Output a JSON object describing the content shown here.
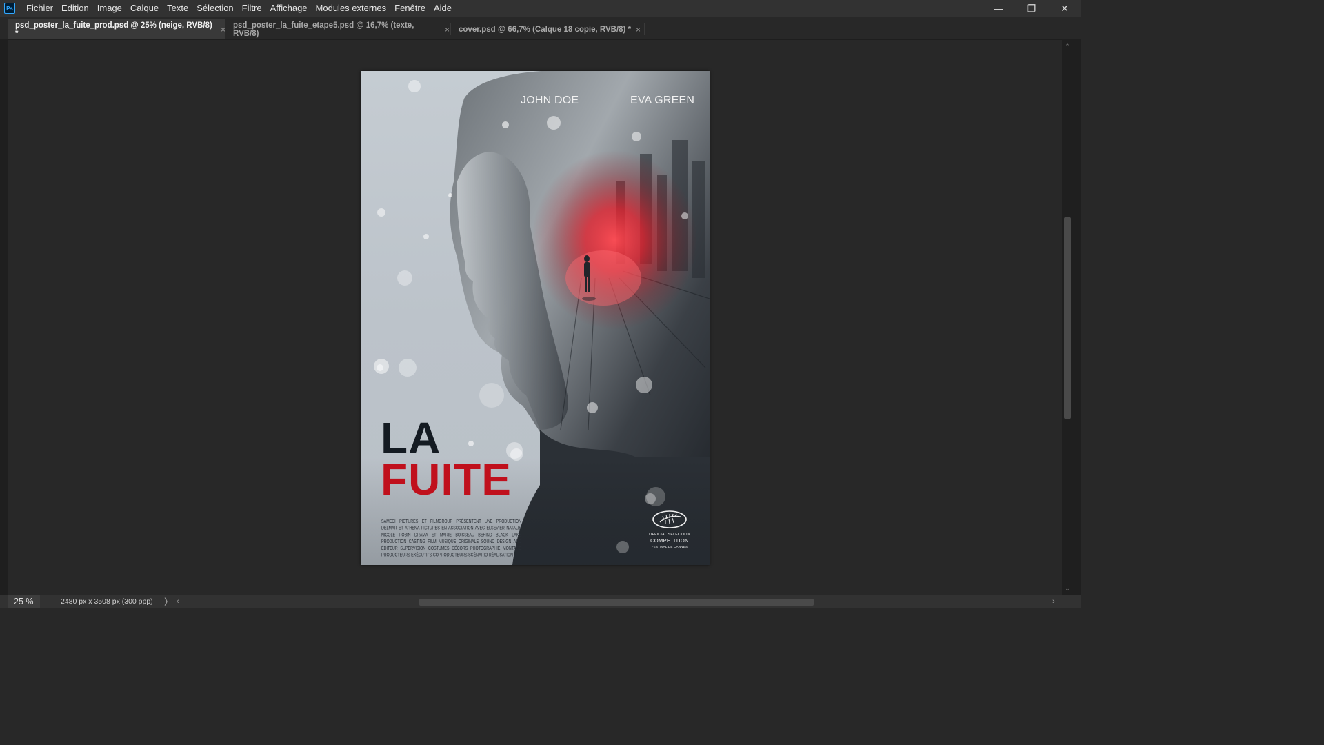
{
  "app": {
    "logo_text": "Ps"
  },
  "menu": {
    "items": [
      "Fichier",
      "Edition",
      "Image",
      "Calque",
      "Texte",
      "Sélection",
      "Filtre",
      "Affichage",
      "Modules externes",
      "Fenêtre",
      "Aide"
    ]
  },
  "window_controls": {
    "minimize": "—",
    "restore": "❐",
    "close": "✕"
  },
  "tabs": [
    {
      "label": "psd_poster_la_fuite_prod.psd @ 25% (neige, RVB/8) *",
      "active": true,
      "close": "×"
    },
    {
      "label": "psd_poster_la_fuite_etape5.psd @ 16,7% (texte, RVB/8)",
      "active": false,
      "close": "×"
    },
    {
      "label": "cover.psd @ 66,7% (Calque 18 copie, RVB/8) *",
      "active": false,
      "close": "×"
    }
  ],
  "poster": {
    "actor_1": "JOHN DOE",
    "actor_2": "EVA GREEN",
    "title_line_1": "LA",
    "title_line_2": "FUITE",
    "credits": "SAMEDI PICTURES ET FILMGROUP PRÉSENTENT UNE PRODUCTION DELMAR ET ATHENA PICTURES EN ASSOCIATION AVEC ELSEVIER NATALIE NICOLE ROBIN DRAMA ET MARIE BOISSEAU BEHIND BLACK LAKE PRODUCTION CASTING FILM MUSIQUE ORIGINALE SOUND DESIGN AND ÉDITEUR SUPERVISION COSTUMES DÉCORS PHOTOGRAPHIE MONTAGE PRODUCTEURS EXÉCUTIFS COPRODUCTEURS SCÉNARIO RÉALISATION",
    "badge_line_1": "OFFICIAL SELECTION",
    "badge_line_2": "COMPETITION",
    "badge_line_3": "FESTIVAL DE CANNES",
    "title_colors": {
      "line_1": "#141b22",
      "line_2": "#c0101c"
    },
    "glow_color": "#ff2436"
  },
  "status": {
    "zoom": "25 %",
    "doc_info": "2480 px x 3508 px (300 ppp)",
    "arrow_right": "❭",
    "scroll_left": "‹",
    "scroll_right": "›",
    "scroll_up": "⌃",
    "scroll_down": "⌄"
  }
}
